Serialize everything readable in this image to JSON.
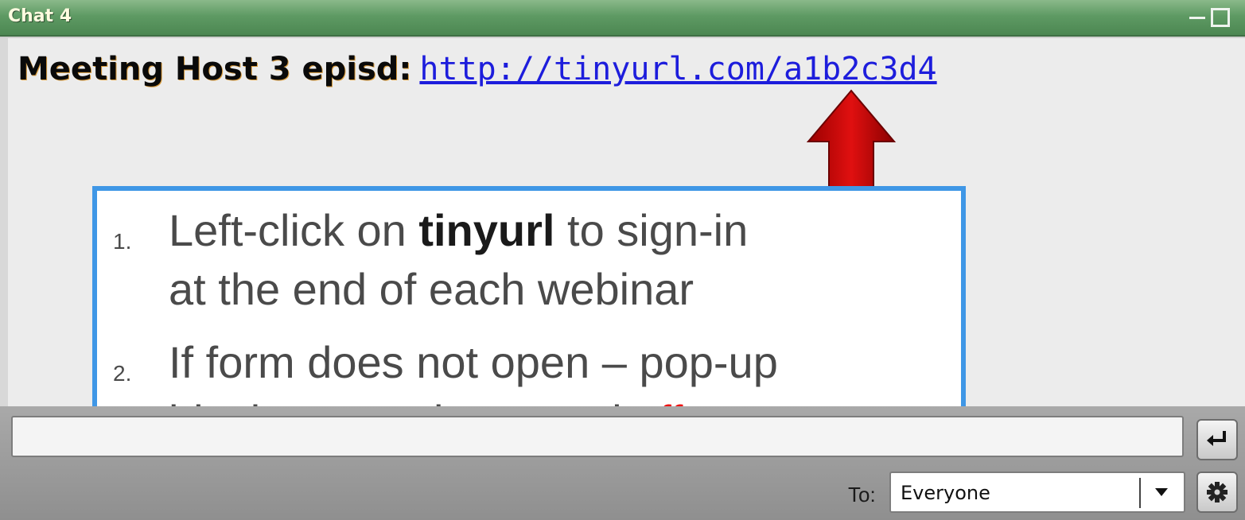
{
  "window": {
    "title": "Chat 4"
  },
  "chat": {
    "sender": "Meeting Host 3 episd:",
    "link": "http://tinyurl.com/a1b2c3d4"
  },
  "callout": {
    "items": [
      {
        "number": "1.",
        "line1_pre": "Left-click on ",
        "line1_bold": "tinyurl",
        "line1_post": " to sign-in",
        "line2": "at the end of each webinar"
      },
      {
        "number": "2.",
        "line1": "If form does not open – pop-up",
        "line2_pre": "blocker must be turned ",
        "line2_red": "off"
      }
    ]
  },
  "composer": {
    "input_value": "",
    "to_label": "To:",
    "recipient": "Everyone"
  },
  "icons": [
    "minimize-icon",
    "maximize-icon",
    "arrow-up-icon",
    "enter-icon",
    "chevron-down-icon",
    "gear-icon"
  ],
  "colors": {
    "titlebar": "#5e9a63",
    "link": "#1d1ddc",
    "arrow": "#cc0000",
    "callout_border": "#3f97e6",
    "highlight": "#ee1111"
  }
}
